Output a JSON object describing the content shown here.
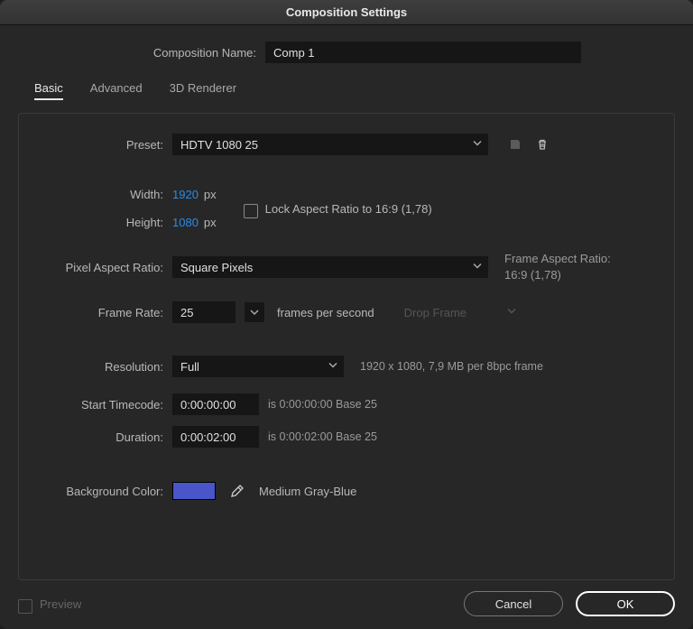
{
  "titlebar": {
    "title": "Composition Settings"
  },
  "name_row": {
    "label": "Composition Name:",
    "value": "Comp 1"
  },
  "tabs": {
    "basic": "Basic",
    "advanced": "Advanced",
    "renderer": "3D Renderer"
  },
  "preset": {
    "label": "Preset:",
    "value": "HDTV 1080 25"
  },
  "width": {
    "label": "Width:",
    "value": "1920",
    "unit": "px"
  },
  "height": {
    "label": "Height:",
    "value": "1080",
    "unit": "px"
  },
  "lock_aspect": {
    "label": "Lock Aspect Ratio to 16:9 (1,78)"
  },
  "par": {
    "label": "Pixel Aspect Ratio:",
    "value": "Square Pixels",
    "frame_label": "Frame Aspect Ratio:",
    "frame_value": "16:9 (1,78)"
  },
  "fps": {
    "label": "Frame Rate:",
    "value": "25",
    "unit": "frames per second",
    "drop": "Drop Frame"
  },
  "resolution": {
    "label": "Resolution:",
    "value": "Full",
    "info": "1920 x 1080, 7,9 MB per 8bpc frame"
  },
  "start_tc": {
    "label": "Start Timecode:",
    "value": "0:00:00:00",
    "info": "is 0:00:00:00  Base 25"
  },
  "duration": {
    "label": "Duration:",
    "value": "0:00:02:00",
    "info": "is 0:00:02:00  Base 25"
  },
  "bg": {
    "label": "Background Color:",
    "swatch": "#4a55c9",
    "name": "Medium Gray-Blue"
  },
  "footer": {
    "preview": "Preview",
    "cancel": "Cancel",
    "ok": "OK"
  }
}
